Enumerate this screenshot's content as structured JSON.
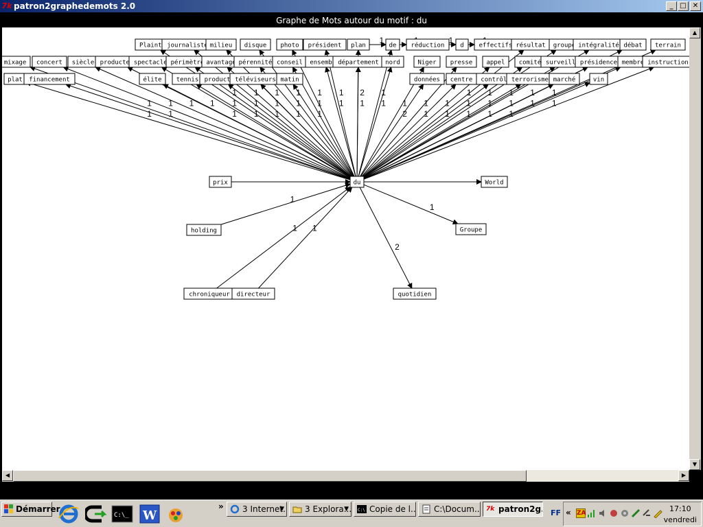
{
  "window": {
    "title": "patron2graphedemots 2.0",
    "minimize": "_",
    "maximize": "□",
    "close": "✕"
  },
  "graph": {
    "heading": "Graphe de Mots autour du motif : du",
    "center": "du",
    "nodes": [
      {
        "id": "Plainte",
        "label": "Plainte"
      },
      {
        "id": "journaliste",
        "label": "journaliste"
      },
      {
        "id": "milieu",
        "label": "milieu"
      },
      {
        "id": "disque",
        "label": "disque"
      },
      {
        "id": "photo",
        "label": "photo"
      },
      {
        "id": "president",
        "label": "président"
      },
      {
        "id": "plan",
        "label": "plan"
      },
      {
        "id": "de",
        "label": "de"
      },
      {
        "id": "reduction",
        "label": "réduction"
      },
      {
        "id": "d",
        "label": "d"
      },
      {
        "id": "effectifs",
        "label": "effectifs"
      },
      {
        "id": "resultat",
        "label": "résultat"
      },
      {
        "id": "groupe",
        "label": "groupe"
      },
      {
        "id": "integralite",
        "label": "intégralité"
      },
      {
        "id": "debat",
        "label": "débat"
      },
      {
        "id": "terrain",
        "label": "terrain"
      },
      {
        "id": "mixage",
        "label": "mixage"
      },
      {
        "id": "concert",
        "label": "concert"
      },
      {
        "id": "siecle",
        "label": "siècle"
      },
      {
        "id": "producteu",
        "label": "producteu"
      },
      {
        "id": "spectacles",
        "label": "spectacles"
      },
      {
        "id": "perimetre",
        "label": "périmètre"
      },
      {
        "id": "avantage",
        "label": "avantage"
      },
      {
        "id": "perennite",
        "label": "pérennité"
      },
      {
        "id": "conseil",
        "label": "conseil"
      },
      {
        "id": "ensemble",
        "label": "ensemble"
      },
      {
        "id": "departement",
        "label": "département"
      },
      {
        "id": "nord",
        "label": "nord"
      },
      {
        "id": "Niger",
        "label": "Niger"
      },
      {
        "id": "presse",
        "label": "presse"
      },
      {
        "id": "appel",
        "label": "appel"
      },
      {
        "id": "comite",
        "label": "comité"
      },
      {
        "id": "surveillan",
        "label": "surveillan"
      },
      {
        "id": "presidence",
        "label": "présidence"
      },
      {
        "id": "membre",
        "label": "membre"
      },
      {
        "id": "instruction",
        "label": "instruction"
      },
      {
        "id": "plat",
        "label": "plat"
      },
      {
        "id": "financement",
        "label": "financement"
      },
      {
        "id": "elite",
        "label": "élite"
      },
      {
        "id": "tennis",
        "label": "tennis"
      },
      {
        "id": "productio",
        "label": "productio"
      },
      {
        "id": "televiseurs",
        "label": "téléviseurs"
      },
      {
        "id": "matin",
        "label": "matin"
      },
      {
        "id": "donnees",
        "label": "données"
      },
      {
        "id": "centre",
        "label": "centre"
      },
      {
        "id": "controle",
        "label": "contrôle"
      },
      {
        "id": "terrorisme",
        "label": "terrorisme"
      },
      {
        "id": "marche",
        "label": "marché"
      },
      {
        "id": "vin",
        "label": "vin"
      },
      {
        "id": "prix",
        "label": "prix"
      },
      {
        "id": "World",
        "label": "World"
      },
      {
        "id": "holding",
        "label": "holding"
      },
      {
        "id": "Groupe",
        "label": "Groupe"
      },
      {
        "id": "chroniqueur",
        "label": "chroniqueur"
      },
      {
        "id": "directeur",
        "label": "directeur"
      },
      {
        "id": "quotidien",
        "label": "quotidien"
      }
    ],
    "edges": [
      {
        "from": "du",
        "to": "mixage",
        "w": "1"
      },
      {
        "from": "du",
        "to": "concert",
        "w": "1"
      },
      {
        "from": "du",
        "to": "siecle",
        "w": "1"
      },
      {
        "from": "du",
        "to": "plat",
        "w": "1"
      },
      {
        "from": "du",
        "to": "financement",
        "w": "1"
      },
      {
        "from": "du",
        "to": "producteu",
        "w": "1"
      },
      {
        "from": "du",
        "to": "spectacles",
        "w": "1"
      },
      {
        "from": "du",
        "to": "elite",
        "w": "1"
      },
      {
        "from": "du",
        "to": "perimetre",
        "w": "1"
      },
      {
        "from": "du",
        "to": "Plainte",
        "w": "1"
      },
      {
        "from": "du",
        "to": "journaliste",
        "w": "1"
      },
      {
        "from": "du",
        "to": "tennis",
        "w": "1"
      },
      {
        "from": "du",
        "to": "milieu",
        "w": "1"
      },
      {
        "from": "du",
        "to": "avantage",
        "w": "1"
      },
      {
        "from": "du",
        "to": "productio",
        "w": "1"
      },
      {
        "from": "du",
        "to": "perennite",
        "w": "1"
      },
      {
        "from": "du",
        "to": "televiseurs",
        "w": "1"
      },
      {
        "from": "du",
        "to": "disque",
        "w": "1"
      },
      {
        "from": "du",
        "to": "conseil",
        "w": "1"
      },
      {
        "from": "du",
        "to": "matin",
        "w": "1"
      },
      {
        "from": "du",
        "to": "photo",
        "w": "1"
      },
      {
        "from": "du",
        "to": "president",
        "w": "1"
      },
      {
        "from": "du",
        "to": "ensemble",
        "w": "1"
      },
      {
        "from": "du",
        "to": "plan",
        "w": "2"
      },
      {
        "from": "du",
        "to": "departement",
        "w": "1"
      },
      {
        "from": "du",
        "to": "de",
        "w": "1"
      },
      {
        "from": "du",
        "to": "nord",
        "w": "1"
      },
      {
        "from": "du",
        "to": "donnees",
        "w": "2"
      },
      {
        "from": "du",
        "to": "Niger",
        "w": "1"
      },
      {
        "from": "du",
        "to": "centre",
        "w": "1"
      },
      {
        "from": "du",
        "to": "presse",
        "w": "1"
      },
      {
        "from": "du",
        "to": "controle",
        "w": "1"
      },
      {
        "from": "du",
        "to": "appel",
        "w": "1"
      },
      {
        "from": "du",
        "to": "terrorisme",
        "w": "1"
      },
      {
        "from": "du",
        "to": "comite",
        "w": "1"
      },
      {
        "from": "du",
        "to": "resultat",
        "w": "1"
      },
      {
        "from": "du",
        "to": "marche",
        "w": "1"
      },
      {
        "from": "du",
        "to": "groupe",
        "w": "1"
      },
      {
        "from": "du",
        "to": "surveillan",
        "w": "1"
      },
      {
        "from": "du",
        "to": "vin",
        "w": "1"
      },
      {
        "from": "du",
        "to": "presidence",
        "w": "1"
      },
      {
        "from": "du",
        "to": "integralite",
        "w": "1"
      },
      {
        "from": "du",
        "to": "membre",
        "w": "1"
      },
      {
        "from": "du",
        "to": "debat",
        "w": "1"
      },
      {
        "from": "du",
        "to": "instruction",
        "w": "1"
      },
      {
        "from": "du",
        "to": "terrain",
        "w": "1"
      },
      {
        "from": "prix",
        "to": "du",
        "w": ""
      },
      {
        "from": "du",
        "to": "World",
        "w": ""
      },
      {
        "from": "holding",
        "to": "du",
        "w": "1"
      },
      {
        "from": "chroniqueur",
        "to": "du",
        "w": "1"
      },
      {
        "from": "directeur",
        "to": "du",
        "w": "1"
      },
      {
        "from": "du",
        "to": "Groupe",
        "w": "1"
      },
      {
        "from": "du",
        "to": "quotidien",
        "w": "2"
      },
      {
        "from": "plan",
        "to": "de",
        "w": "1"
      },
      {
        "from": "de",
        "to": "reduction",
        "w": "1"
      },
      {
        "from": "reduction",
        "to": "d",
        "w": "1"
      },
      {
        "from": "d",
        "to": "effectifs",
        "w": "1"
      }
    ]
  },
  "scrollbars": {
    "left": "◀",
    "right": "▶",
    "up": "▲",
    "down": "▼"
  },
  "taskbar": {
    "start": "Démarrer",
    "chevron": "»",
    "tasks": [
      {
        "label": "3 Internet...",
        "icon": "ie-icon"
      },
      {
        "label": "3 Explora...",
        "icon": "folder-icon"
      },
      {
        "label": "Copie de l...",
        "icon": "cmd-icon"
      },
      {
        "label": "C:\\Docum...",
        "icon": "notepad-icon"
      },
      {
        "label": "patron2g...",
        "icon": "tk-icon"
      }
    ],
    "tray_label": "FF",
    "tray_chevron": "«",
    "clock_time": "17:10",
    "clock_day": "vendredi"
  },
  "colors": {
    "titlebar_start": "#0a246a",
    "titlebar_end": "#a6caf0",
    "tk_red": "#e00000"
  }
}
